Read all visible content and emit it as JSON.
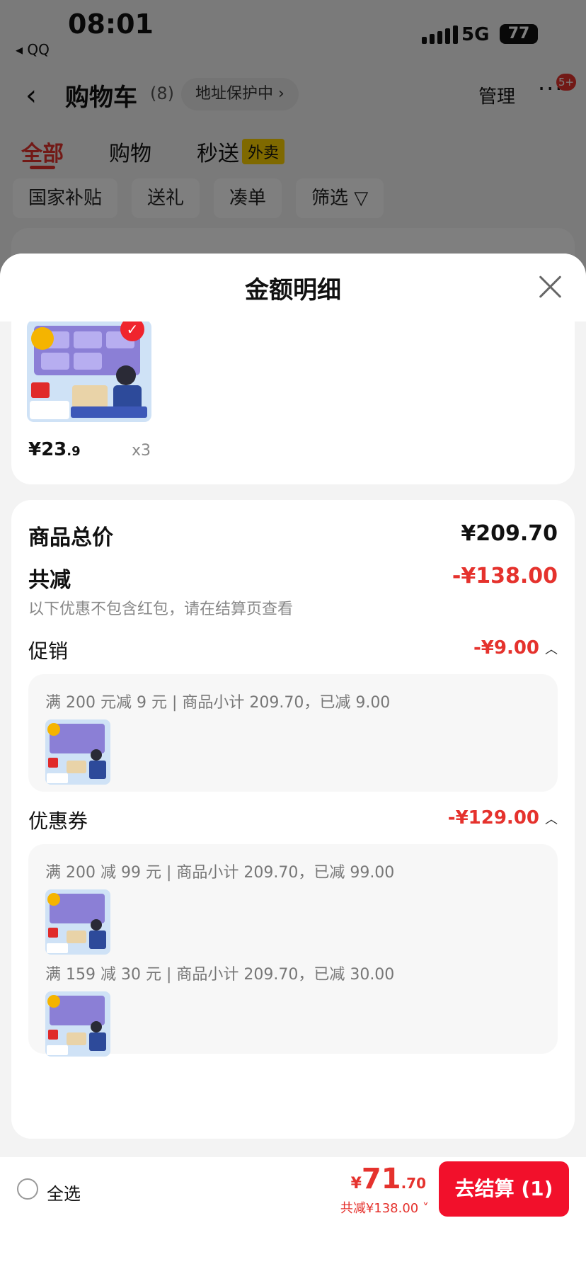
{
  "status_bar": {
    "time": "08:01",
    "back_app": "◂ QQ",
    "network": "5G",
    "battery": "77"
  },
  "header": {
    "back_icon": "chevron-left-icon",
    "title": "购物车",
    "count": "(8)",
    "address_protect": "地址保护中 ›",
    "manage": "管理",
    "more": "···",
    "badge": "5+"
  },
  "tabs": [
    {
      "label": "全部"
    },
    {
      "label": "购物"
    },
    {
      "label": "秒送"
    }
  ],
  "tab_badge": "外卖",
  "chips": [
    "国家补贴",
    "送礼",
    "凑单",
    "筛选 ▽"
  ],
  "sheet": {
    "title": "金额明细",
    "product": {
      "price_int": "¥23",
      "price_dec": ".9",
      "qty": "x3"
    },
    "summary": {
      "total_label": "商品总价",
      "total_value": "¥209.70",
      "discount_label": "共减",
      "discount_value": "-¥138.00",
      "note": "以下优惠不包含红包，请在结算页查看"
    },
    "promotion": {
      "label": "促销",
      "value": "-¥9.00",
      "lines": [
        "满 200 元减 9 元 | 商品小计 209.70，已减 9.00"
      ]
    },
    "coupon": {
      "label": "优惠券",
      "value": "-¥129.00",
      "lines": [
        "满 200 减 99 元 | 商品小计 209.70，已减 99.00",
        "满 159 减 30 元 | 商品小计 209.70，已减 30.00"
      ]
    }
  },
  "bottom_bar": {
    "select_all": "全选",
    "total_currency": "¥",
    "total_int": "71",
    "total_dec": ".70",
    "saved": "共减¥138.00",
    "checkout": "去结算 (1)"
  },
  "colors": {
    "accent": "#e5322d",
    "checkout": "#f2102b"
  }
}
